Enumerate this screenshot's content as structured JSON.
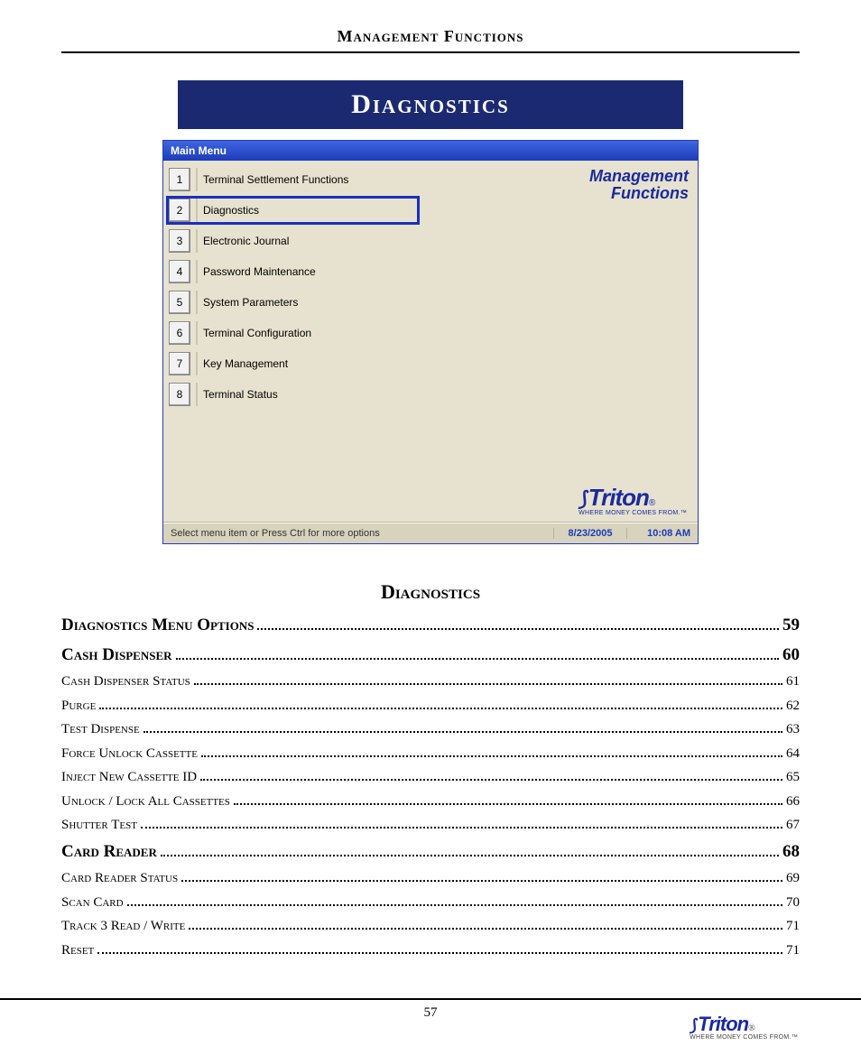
{
  "header": {
    "title": "Management Functions"
  },
  "banner": {
    "title": "Diagnostics"
  },
  "screenshot": {
    "window_title": "Main Menu",
    "right_label": "Management\nFunctions",
    "menu_items": [
      {
        "num": "1",
        "label": "Terminal Settlement Functions",
        "selected": false
      },
      {
        "num": "2",
        "label": "Diagnostics",
        "selected": true
      },
      {
        "num": "3",
        "label": "Electronic Journal",
        "selected": false
      },
      {
        "num": "4",
        "label": "Password Maintenance",
        "selected": false
      },
      {
        "num": "5",
        "label": "System Parameters",
        "selected": false
      },
      {
        "num": "6",
        "label": "Terminal Configuration",
        "selected": false
      },
      {
        "num": "7",
        "label": "Key Management",
        "selected": false
      },
      {
        "num": "8",
        "label": "Terminal Status",
        "selected": false
      }
    ],
    "logo_word": "Triton",
    "logo_tagline": "WHERE MONEY COMES FROM.™",
    "status_hint": "Select menu item or Press Ctrl for more options",
    "status_date": "8/23/2005",
    "status_time": "10:08 AM"
  },
  "toc": {
    "title": "Diagnostics",
    "entries": [
      {
        "label": "Diagnostics Menu Options",
        "page": "59",
        "level": "major"
      },
      {
        "label": "Cash Dispenser",
        "page": "60",
        "level": "major"
      },
      {
        "label": "Cash Dispenser Status",
        "page": "61",
        "level": "minor"
      },
      {
        "label": "Purge",
        "page": "62",
        "level": "minor"
      },
      {
        "label": "Test Dispense",
        "page": "63",
        "level": "minor"
      },
      {
        "label": "Force Unlock Cassette",
        "page": "64",
        "level": "minor"
      },
      {
        "label": "Inject New Cassette ID",
        "page": "65",
        "level": "minor"
      },
      {
        "label": "Unlock / Lock All Cassettes",
        "page": "66",
        "level": "minor"
      },
      {
        "label": "Shutter Test",
        "page": "67",
        "level": "minor"
      },
      {
        "label": "Card Reader",
        "page": "68",
        "level": "major"
      },
      {
        "label": "Card Reader Status",
        "page": "69",
        "level": "minor"
      },
      {
        "label": "Scan Card",
        "page": "70",
        "level": "minor"
      },
      {
        "label": "Track 3 Read / Write",
        "page": "71",
        "level": "minor"
      },
      {
        "label": "Reset",
        "page": "71",
        "level": "minor"
      }
    ]
  },
  "footer": {
    "page_number": "57",
    "logo_word": "Triton",
    "logo_tagline": "WHERE MONEY COMES FROM.™"
  }
}
